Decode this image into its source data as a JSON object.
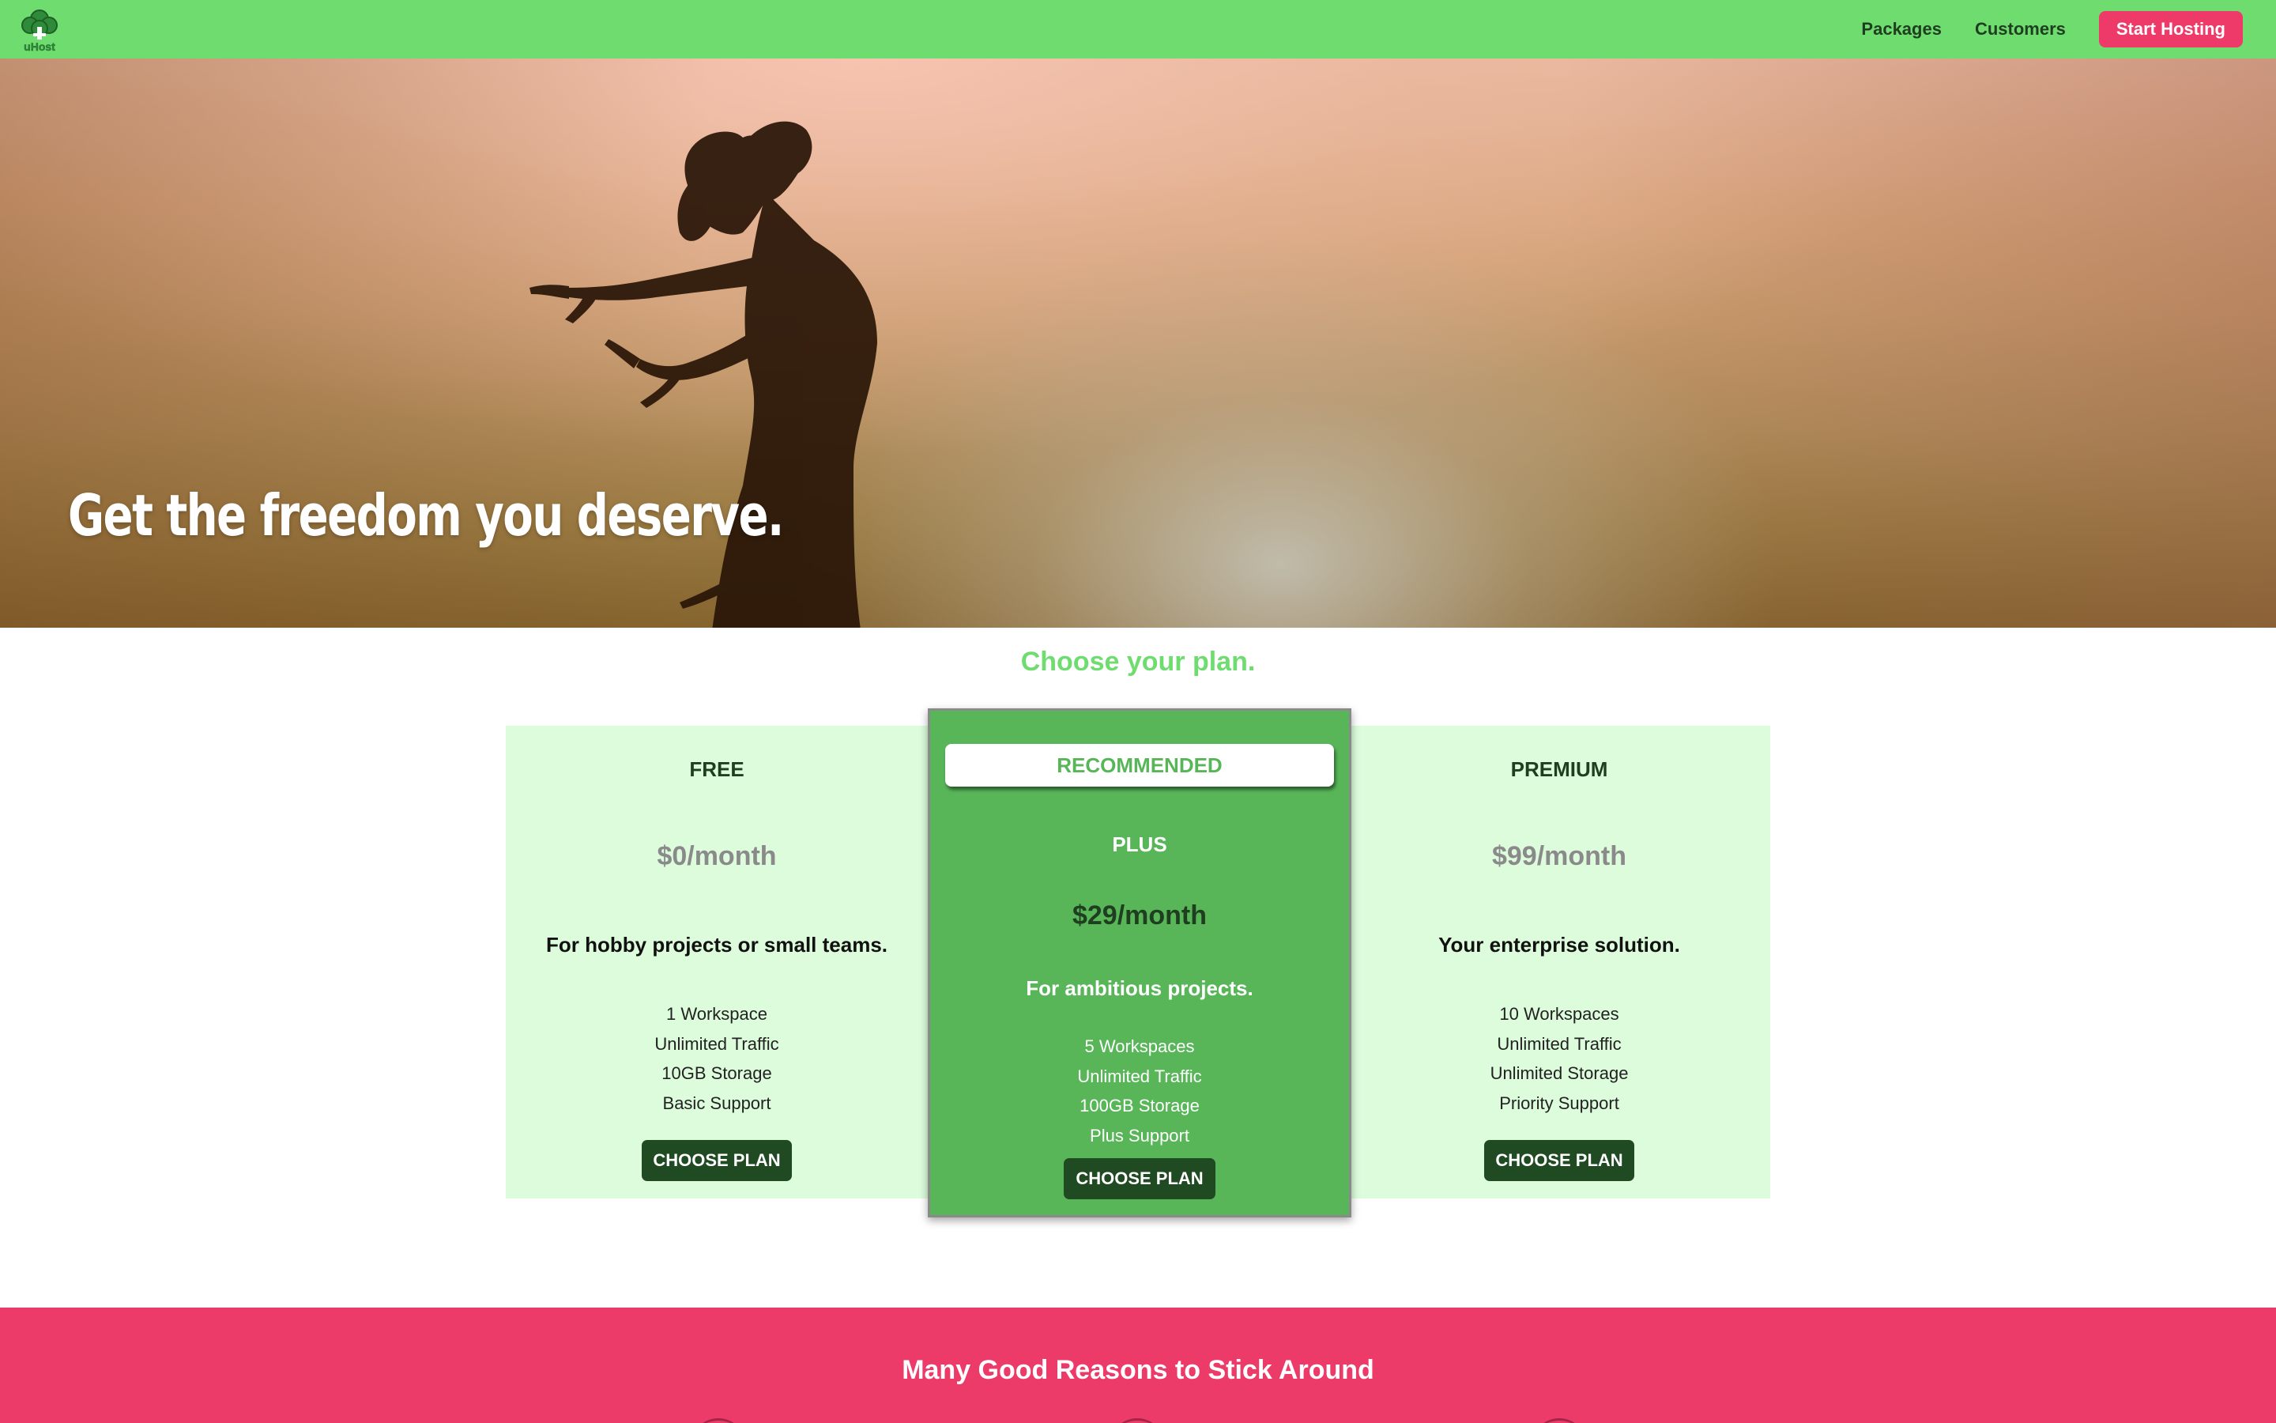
{
  "header": {
    "logo_text": "uHost",
    "nav": {
      "packages": "Packages",
      "customers": "Customers",
      "cta": "Start Hosting"
    },
    "colors": {
      "background": "#6fdc6f",
      "cta": "#ee3a69"
    }
  },
  "hero": {
    "title": "Get the freedom you deserve."
  },
  "pricing": {
    "heading": "Choose your plan.",
    "plans": [
      {
        "name": "FREE",
        "price": "$0/month",
        "description": "For hobby projects or small teams.",
        "features": [
          "1 Workspace",
          "Unlimited Traffic",
          "10GB Storage",
          "Basic Support"
        ],
        "button": "CHOOSE PLAN"
      },
      {
        "badge": "RECOMMENDED",
        "name": "PLUS",
        "price": "$29/month",
        "description": "For ambitious projects.",
        "features": [
          "5 Workspaces",
          "Unlimited Traffic",
          "100GB Storage",
          "Plus Support"
        ],
        "button": "CHOOSE PLAN"
      },
      {
        "name": "PREMIUM",
        "price": "$99/month",
        "description": "Your enterprise solution.",
        "features": [
          "10 Workspaces",
          "Unlimited Traffic",
          "Unlimited Storage",
          "Priority Support"
        ],
        "button": "CHOOSE PLAN"
      }
    ],
    "colors": {
      "side_card": "#dcfcdc",
      "plus_card": "#58b659",
      "button": "#1f4a22",
      "heading": "#6fdc6f"
    }
  },
  "reasons": {
    "title": "Many Good Reasons to Stick Around",
    "color": "#ec3a69"
  }
}
